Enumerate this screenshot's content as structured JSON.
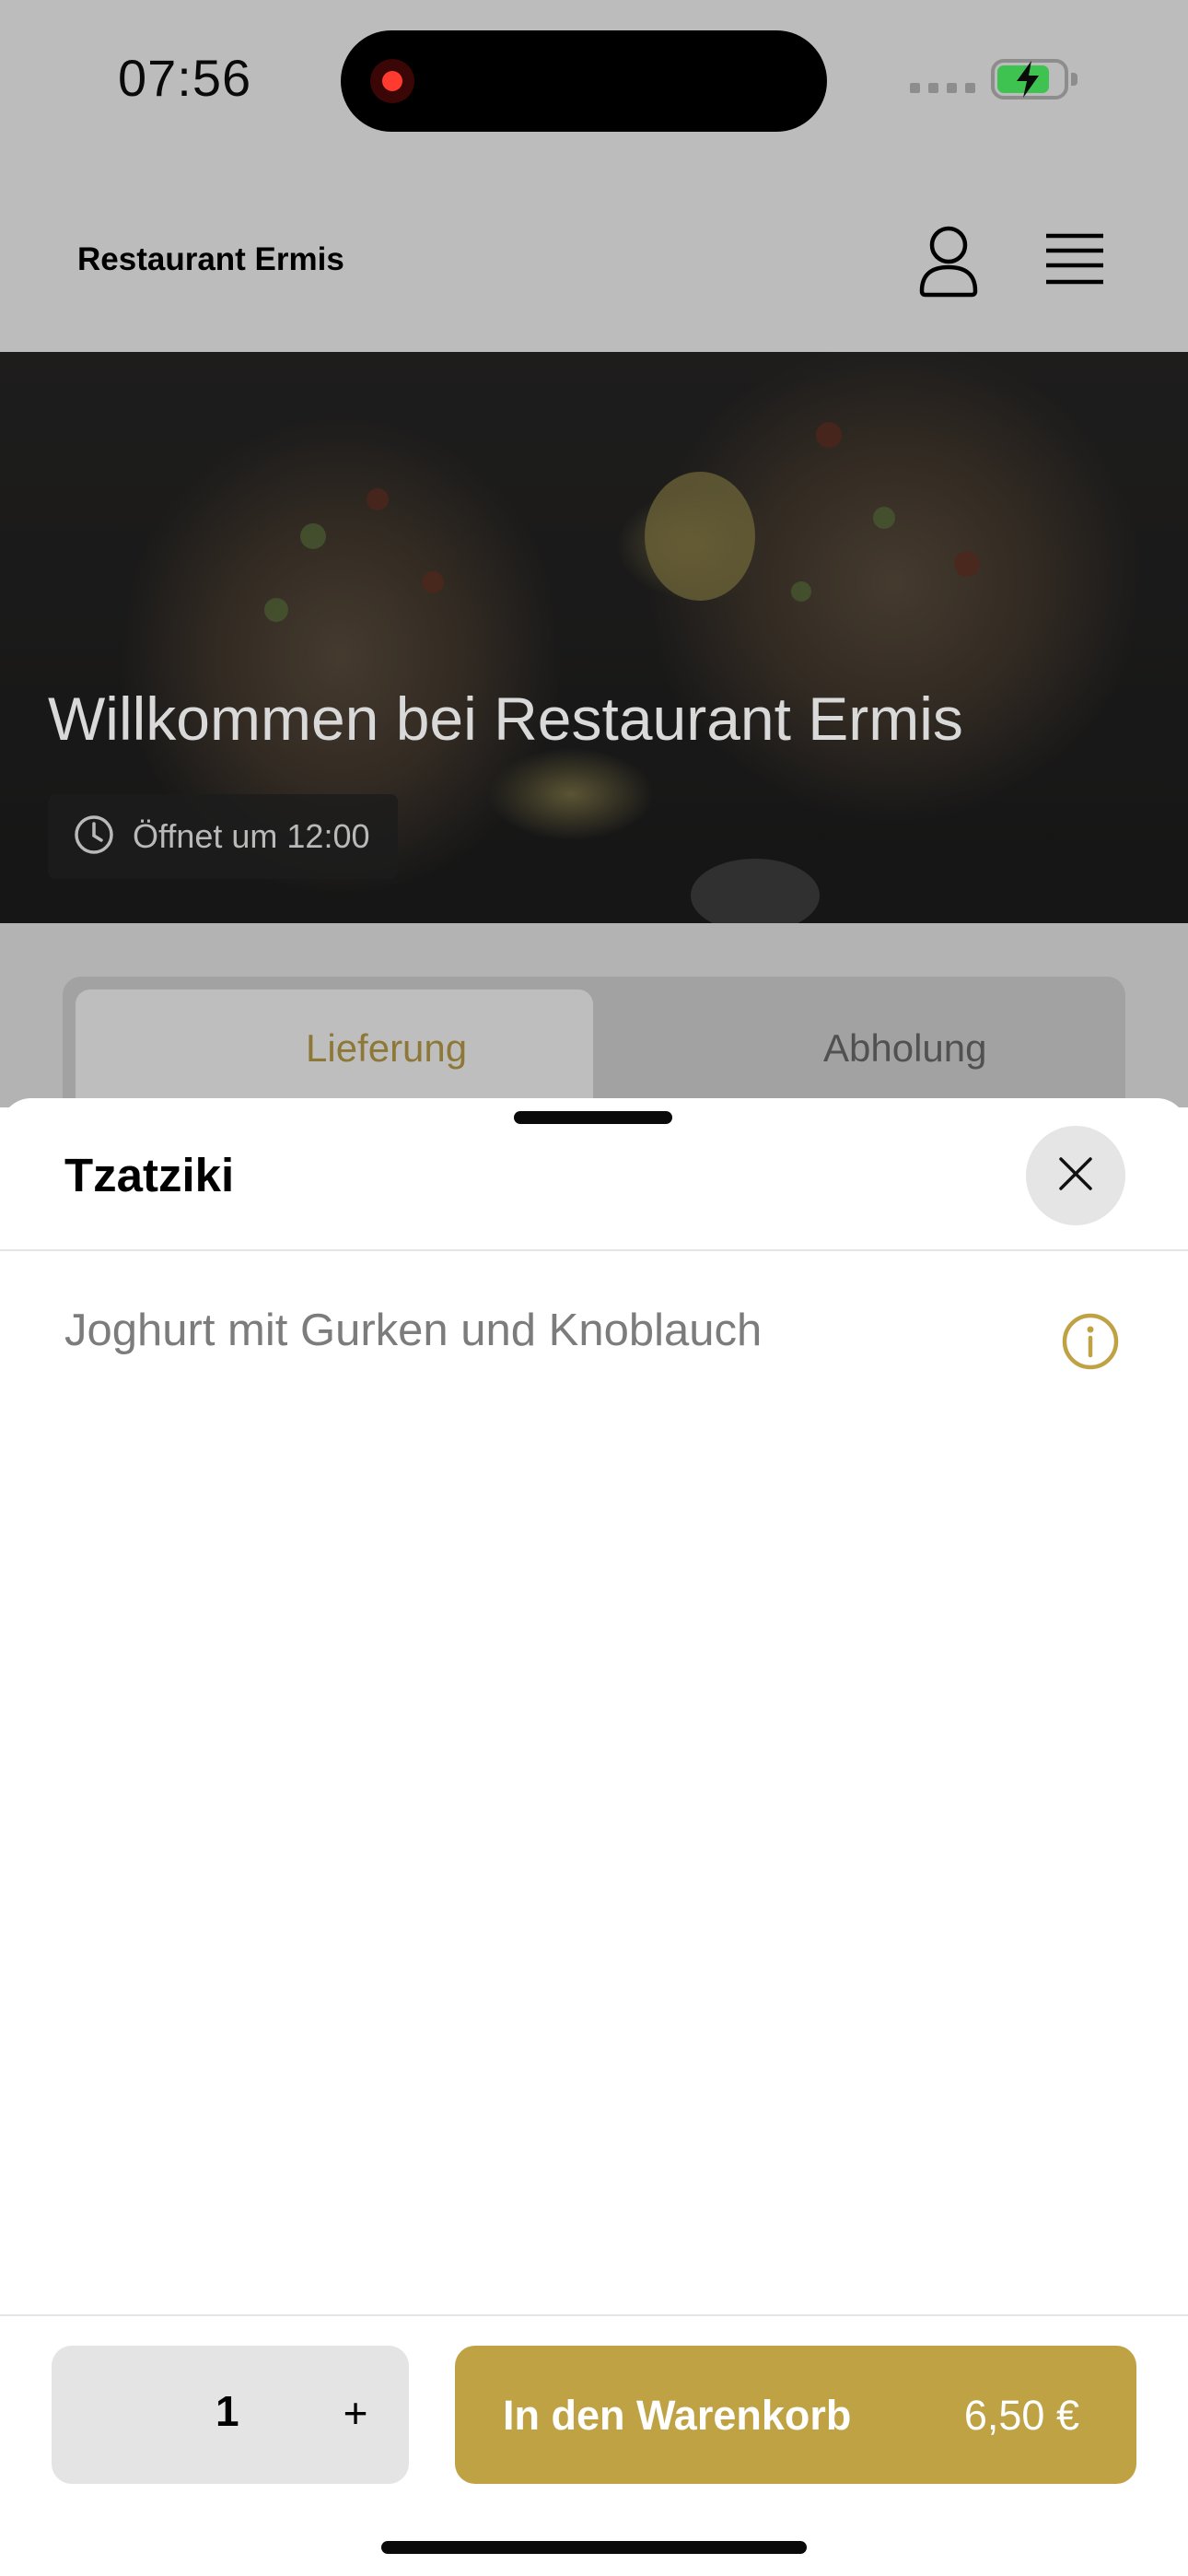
{
  "status_bar": {
    "time": "07:56",
    "icons": [
      "recording-indicator-icon",
      "signal-icon",
      "battery-charging-icon"
    ]
  },
  "header": {
    "title": "Restaurant Ermis",
    "icons": [
      "user-icon",
      "menu-icon"
    ]
  },
  "hero": {
    "title": "Willkommen bei Restaurant Ermis",
    "badge": "Öffnet um 12:00",
    "badge_icon": "clock-icon"
  },
  "order_tabs": [
    {
      "label": "Lieferung",
      "active": true
    },
    {
      "label": "Abholung",
      "active": false
    }
  ],
  "sheet": {
    "title": "Tzatziki",
    "description": "Joghurt mit Gurken und Knoblauch",
    "icons": [
      "close-icon",
      "info-icon"
    ]
  },
  "footer": {
    "quantity": "1",
    "plus_label": "+",
    "add_to_cart_label": "In den Warenkorb",
    "price": "6,50 €"
  },
  "colors": {
    "accent": "#bfa244",
    "accent_dimmed": "#8d7838",
    "overlay": "#bcbcbc",
    "text_muted": "#7c7c7c"
  }
}
